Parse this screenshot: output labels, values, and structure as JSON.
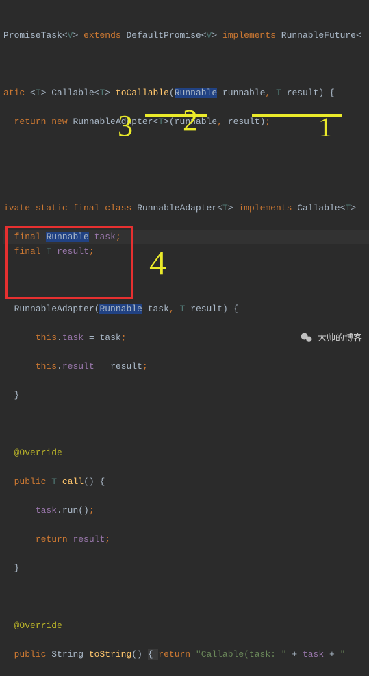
{
  "code": {
    "line1_promiseTask": "PromiseTask",
    "line1_extends": "extends",
    "line1_defaultPromise": "DefaultPromise",
    "line1_implements": "implements",
    "line1_runnableFuture": "RunnableFuture",
    "line2_atic": "atic",
    "line2_callable": "Callable",
    "line2_toCallable": "toCallable",
    "line2_runnable_type": "Runnable",
    "line2_runnable_param": "runnable",
    "line2_T": "T",
    "line2_result": "result",
    "line3_return": "return",
    "line3_new": "new",
    "line3_runnableAdapter": "RunnableAdapter",
    "line3_T": "T",
    "line3_runnable": "runnable",
    "line3_result": "result",
    "line4_ivate": "ivate",
    "line4_static": "static",
    "line4_final": "final",
    "line4_class": "class",
    "line4_runnableAdapter": "RunnableAdapter",
    "line4_T": "T",
    "line4_implements": "implements",
    "line4_callable": "Callable",
    "line5_final": "final",
    "line5_runnable": "Runnable",
    "line5_task": "task",
    "line6_final": "final",
    "line6_T": "T",
    "line6_result": "result",
    "line7_runnableAdapter": "RunnableAdapter",
    "line7_runnable": "Runnable",
    "line7_task_param": "task",
    "line7_T": "T",
    "line7_result_param": "result",
    "line8_this": "this",
    "line8_task_field": "task",
    "line8_task_val": "task",
    "line9_this": "this",
    "line9_result_field": "result",
    "line9_result_val": "result",
    "override": "@Override",
    "line11_public": "public",
    "line11_T": "T",
    "line11_call": "call",
    "line12_task": "task",
    "line12_run": "run",
    "line13_return": "return",
    "line13_result": "result",
    "line16_public": "public",
    "line16_string": "String",
    "line16_toString": "toString",
    "line16_return": "return",
    "line16_str1": "\"Callable(task: \"",
    "line16_task": "task",
    "line16_plus": "+",
    "line16_str2": "\""
  },
  "annotations": {
    "num1": "1",
    "num2": "2",
    "num3": "3",
    "num4": "4"
  },
  "watermark": {
    "text": "大帅的博客"
  }
}
